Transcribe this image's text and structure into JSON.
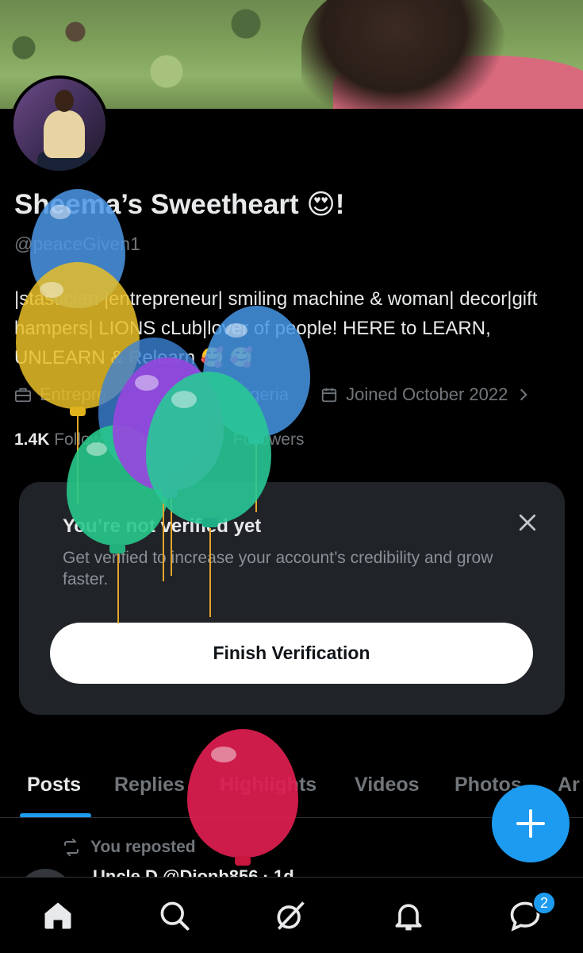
{
  "profile": {
    "display_name": "Sheema’s Sweetheart 😍!",
    "handle": "@peaceGiven1",
    "bio": "|stastician |entrepreneur| smiling machine & woman| decor|gift hampers| LIONS cLub|lover of people! HERE to LEARN, UNLEARN & Relearn 🥰 🥰",
    "category": "Entrepre",
    "location": "Nigeria",
    "joined": "Joined October 2022",
    "following_count": "1.4K",
    "following_label": "Following",
    "followers_label": "Followers"
  },
  "verification": {
    "title": "You’re not verified yet",
    "description": "Get verified to increase your account’s credibility and grow faster.",
    "button_label": "Finish Verification"
  },
  "tabs": [
    "Posts",
    "Replies",
    "Highlights",
    "Videos",
    "Photos",
    "Ar"
  ],
  "active_tab": "Posts",
  "feed": {
    "repost_label": "You reposted",
    "peek_text": "Uncle D @Dionb856 · 1d"
  },
  "bottom_nav": {
    "items": [
      "home-icon",
      "search-icon",
      "grok-icon",
      "notifications-icon",
      "messages-icon"
    ],
    "messages_badge": "2"
  },
  "colors": {
    "accent": "#1d9bf0",
    "background": "#000000",
    "card": "#202327",
    "muted_text": "#71767b"
  }
}
